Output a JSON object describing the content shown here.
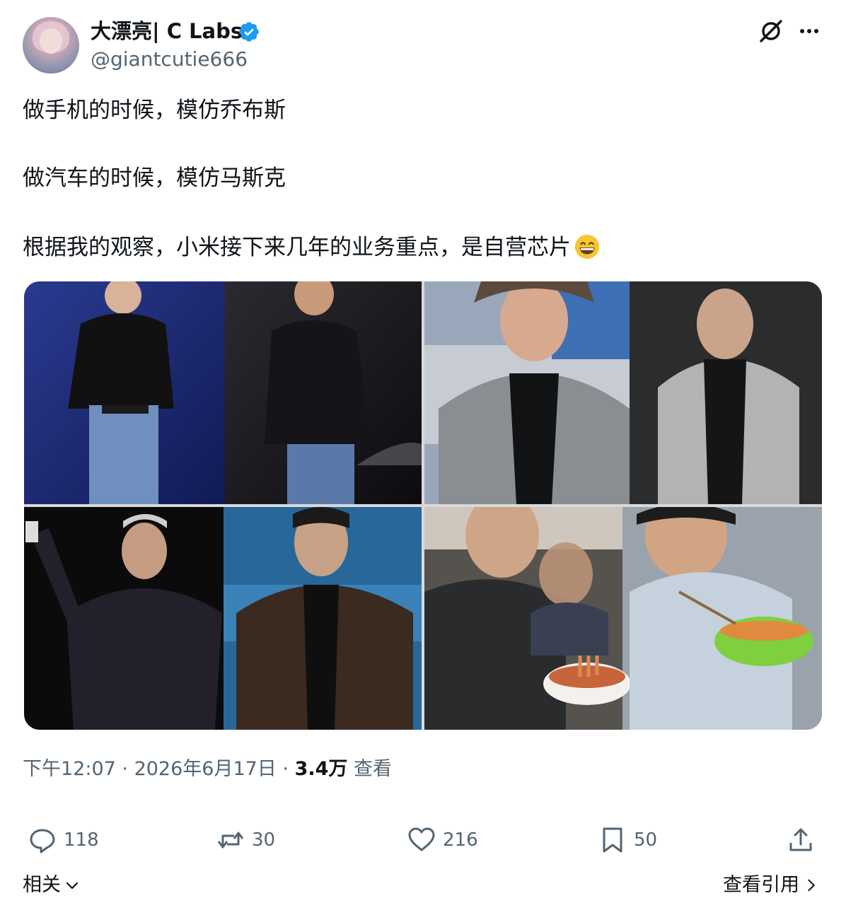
{
  "author": {
    "display_name": "大漂亮| C Labs",
    "handle": "@giantcutie666",
    "verified": true
  },
  "post": {
    "lines": [
      "做手机的时候，模仿乔布斯",
      "做汽车的时候，模仿马斯克",
      "根据我的观察，小米接下来几年的业务重点，是自营芯片"
    ],
    "emoji": "grinning-face-with-smiling-eyes"
  },
  "meta": {
    "time": "下午12:07",
    "date": "2026年6月17日",
    "views_count": "3.4万",
    "views_label": "查看"
  },
  "actions": {
    "replies": "118",
    "reposts": "30",
    "likes": "216",
    "bookmarks": "50"
  },
  "footer": {
    "related_label": "相关",
    "quotes_label": "查看引用"
  },
  "colors": {
    "text_primary": "#0f1419",
    "text_secondary": "#536471",
    "verified_blue": "#1d9bf0"
  }
}
